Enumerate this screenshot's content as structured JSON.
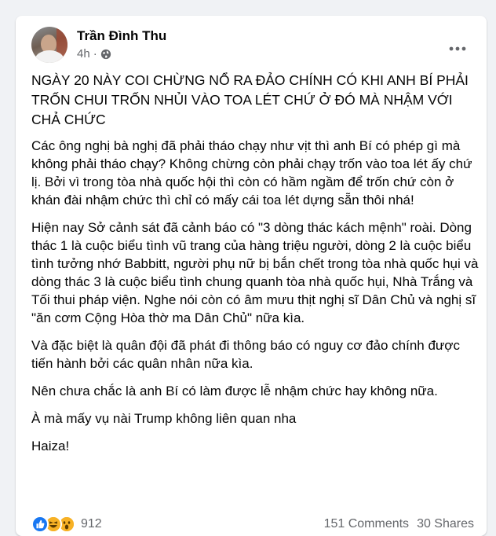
{
  "post": {
    "author": "Trần Đình Thu",
    "time": "4h",
    "separator": "·",
    "headline": "NGÀY 20 NÀY COI CHỪNG NỔ RA ĐẢO CHÍNH CÓ KHI ANH BÍ PHẢI TRỐN CHUI TRỐN NHỦI VÀO TOA LÉT CHỨ Ở ĐÓ MÀ NHẬM VỚI CHẢ CHỨC",
    "paragraphs": [
      "Các ông nghị bà nghị đã phải tháo chạy như vịt thì anh Bí có phép gì mà không phải tháo chạy? Không chừng còn phải chạy trốn vào toa lét ấy chứ lị. Bởi vì trong tòa nhà quốc hội thì còn có hầm ngầm để trốn chứ còn ở khán đài nhậm chức thì chỉ có mấy cái toa lét dựng sẵn thôi nhá!",
      "Hiện nay Sở cảnh sát đã cảnh báo có \"3 dòng thác kách mệnh\" roài. Dòng thác 1 là cuộc biểu tình vũ trang của hàng triệu người, dòng 2 là cuộc biểu tình tưởng nhớ Babbitt, người phụ nữ bị bắn chết trong tòa nhà quốc hụi và dòng thác 3 là cuộc biểu tình chung quanh tòa nhà quốc hụi, Nhà Trắng và Tối thui  pháp viện. Nghe nói còn có âm mưu thịt nghị sĩ Dân Chủ và nghị sĩ \"ăn cơm Cộng Hòa thờ ma Dân Chủ\" nữa kìa.",
      "Và đặc biệt là quân đội đã phát đi thông báo có nguy cơ đảo chính được tiến hành bởi các quân nhân nữa kìa.",
      "Nên chưa chắc là anh Bí có làm được lễ nhậm chức hay không nữa.",
      "À mà mấy vụ nài Trump không liên quan nha",
      "Haiza!"
    ],
    "reaction_count": "912",
    "comments": "151 Comments",
    "shares": "30 Shares"
  },
  "icons": {
    "avatar": "profile-photo",
    "privacy": "globe-icon",
    "more": "more-options-icon",
    "reactions": [
      "like-icon",
      "haha-icon",
      "wow-icon"
    ]
  },
  "colors": {
    "background": "#f0f2f5",
    "card": "#ffffff",
    "text": "#050505",
    "secondary_text": "#65676b",
    "like_blue": "#1877f2",
    "reaction_yellow": "#f7b125"
  }
}
